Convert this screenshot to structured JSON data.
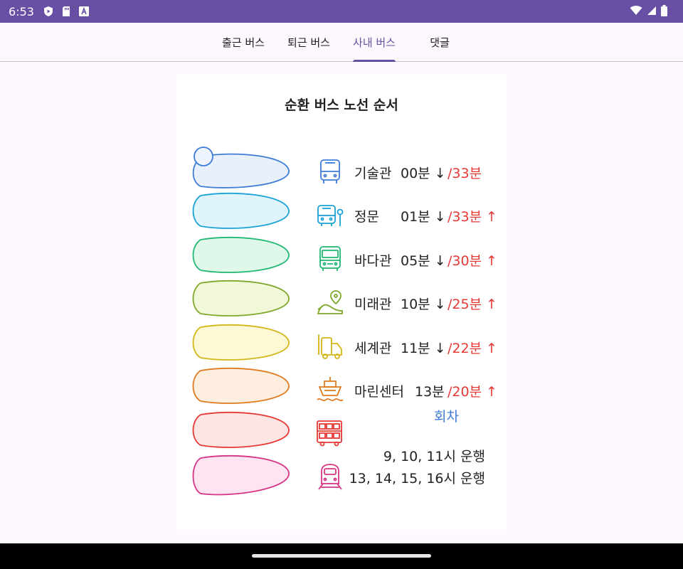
{
  "status_bar": {
    "time": "6:53",
    "left_icons": [
      "play-protect-icon",
      "sd-card-icon",
      "keyboard-a-icon"
    ],
    "right_icons": [
      "wifi-icon",
      "signal-icon",
      "battery-icon"
    ]
  },
  "tabs": [
    {
      "label": "출근 버스",
      "active": false
    },
    {
      "label": "퇴근 버스",
      "active": false
    },
    {
      "label": "사내 버스",
      "active": true
    },
    {
      "label": "댓글",
      "active": false
    }
  ],
  "route": {
    "title": "순환 버스 노선 순서",
    "stops": [
      {
        "name": "기술관",
        "time": "00분 ↓",
        "return": "/33분",
        "icon": "bus-front-icon",
        "color": "#3f7bd8"
      },
      {
        "name": "정문",
        "time": "01분 ↓",
        "return": "/33분 ↑",
        "icon": "bus-stop-icon",
        "color": "#1aa3d6"
      },
      {
        "name": "바다관",
        "time": "05분 ↓",
        "return": "/30분 ↑",
        "icon": "bus-icon",
        "color": "#20b873"
      },
      {
        "name": "미래관",
        "time": "10분 ↓",
        "return": "/25분 ↑",
        "icon": "location-route-icon",
        "color": "#7ea82a"
      },
      {
        "name": "세계관",
        "time": "11분 ↓",
        "return": "/22분 ↑",
        "icon": "truck-icon",
        "color": "#d3b618"
      },
      {
        "name": "마린센터",
        "time": "13분",
        "return": "/20분 ↑",
        "icon": "ship-icon",
        "color": "#e07b1f"
      }
    ],
    "turnaround": "회차",
    "extra_icons": [
      {
        "icon": "double-decker-bus-icon",
        "color": "#e53935"
      },
      {
        "icon": "train-icon",
        "color": "#d63384"
      }
    ],
    "schedule": [
      "9, 10, 11시 운행",
      "13, 14, 15, 16시 운행"
    ]
  }
}
